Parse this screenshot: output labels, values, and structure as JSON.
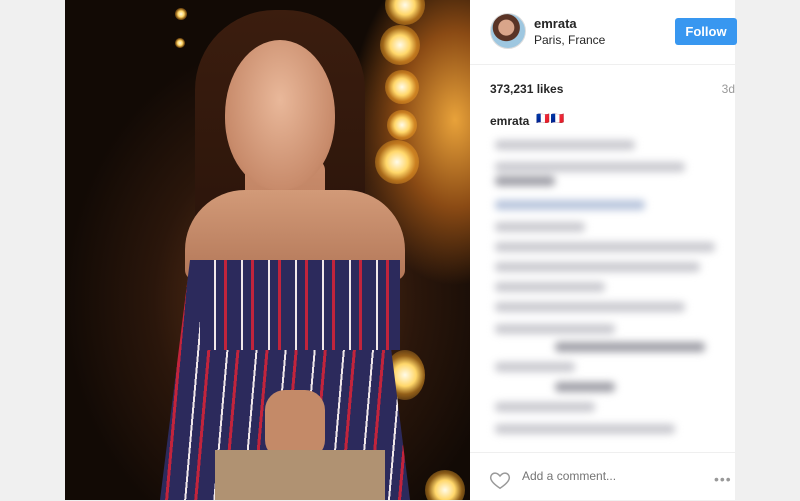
{
  "post": {
    "user": {
      "username": "emrata",
      "location": "Paris, France",
      "avatar_icon": "profile-avatar"
    },
    "follow_label": "Follow",
    "likes": "373,231 likes",
    "age": "3d",
    "caption": {
      "username": "emrata",
      "emoji": "🇫🇷🇫🇷"
    },
    "comment_placeholder": "Add a comment...",
    "more_label": "•••",
    "colors": {
      "follow_button": "#3897f0",
      "text": "#262626",
      "muted": "#999999",
      "background": "#f0f0f0"
    }
  }
}
